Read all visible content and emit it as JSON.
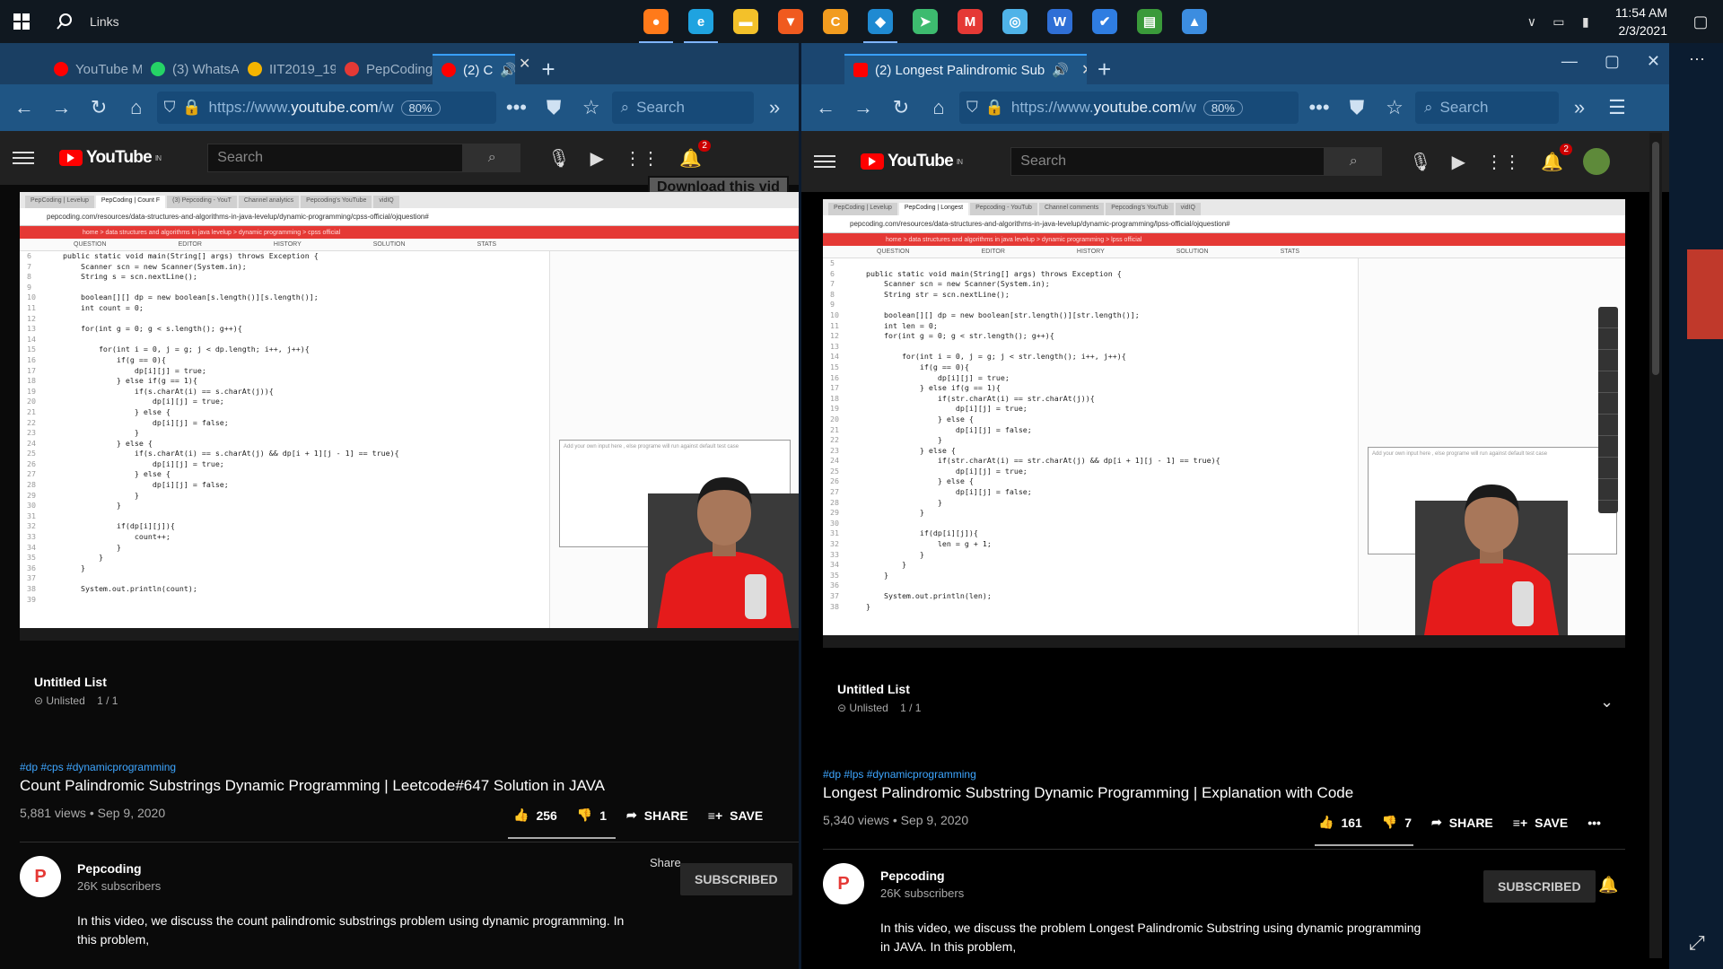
{
  "taskbar": {
    "links_label": "Links",
    "time": "11:54 AM",
    "date": "2/3/2021",
    "apps": [
      {
        "name": "firefox-icon",
        "color": "#ff7a1a",
        "glyph": "●"
      },
      {
        "name": "edge-icon",
        "color": "#1fa3e0",
        "glyph": "e"
      },
      {
        "name": "file-explorer-icon",
        "color": "#f3c12a",
        "glyph": "▬"
      },
      {
        "name": "brave-icon",
        "color": "#f05a1f",
        "glyph": "▼"
      },
      {
        "name": "c-app-icon",
        "color": "#f29c1f",
        "glyph": "C"
      },
      {
        "name": "vscode-icon",
        "color": "#1f8ad2",
        "glyph": "◆"
      },
      {
        "name": "telegram-icon",
        "color": "#3dbb6f",
        "glyph": "➤"
      },
      {
        "name": "gmail-icon",
        "color": "#e53935",
        "glyph": "M"
      },
      {
        "name": "globe-app-icon",
        "color": "#4fb3e8",
        "glyph": "◎"
      },
      {
        "name": "word-icon",
        "color": "#2f6fd6",
        "glyph": "W"
      },
      {
        "name": "todo-icon",
        "color": "#2f7de1",
        "glyph": "✔"
      },
      {
        "name": "excel-chart-icon",
        "color": "#3a9a3a",
        "glyph": "▤"
      },
      {
        "name": "photos-icon",
        "color": "#3c8de0",
        "glyph": "▲"
      }
    ]
  },
  "left": {
    "tabs": [
      {
        "label": "YouTube M",
        "color": "#ff0000"
      },
      {
        "label": "(3) WhatsA",
        "color": "#25d366"
      },
      {
        "label": "IIT2019_19",
        "color": "#f4b400"
      },
      {
        "label": "PepCoding",
        "color": "#e53935"
      },
      {
        "label": "(2) C",
        "color": "#ff0000"
      }
    ],
    "url_prefix": "https://www.",
    "url_host": "youtube.com",
    "url_suffix": "/w",
    "zoom": "80%",
    "search_placeholder": "Search",
    "yt_search_placeholder": "Search",
    "notif_count": "2",
    "download_label": "Download this vid",
    "playlist_title": "Untitled List",
    "playlist_sub": "Unlisted",
    "playlist_pos": "1 / 1",
    "tags": "#dp #cps #dynamicprogramming",
    "title": "Count Palindromic Substrings Dynamic Programming | Leetcode#647 Solution in JAVA",
    "views": "5,881 views • Sep 9, 2020",
    "likes": "256",
    "dislikes": "1",
    "share": "SHARE",
    "save": "SAVE",
    "share_tooltip": "Share",
    "channel": "Pepcoding",
    "subscribers": "26K subscribers",
    "subscribed": "SUBSCRIBED",
    "description": "In this video, we discuss the count palindromic substrings problem using dynamic programming. In this problem,"
  },
  "right": {
    "tab_label": "(2) Longest Palindromic Sub",
    "url_prefix": "https://www.",
    "url_host": "youtube.com",
    "url_suffix": "/w",
    "zoom": "80%",
    "search_placeholder": "Search",
    "yt_search_placeholder": "Search",
    "notif_count": "2",
    "playlist_title": "Untitled List",
    "playlist_sub": "Unlisted",
    "playlist_pos": "1 / 1",
    "tags": "#dp #lps #dynamicprogramming",
    "title": "Longest Palindromic Substring Dynamic Programming | Explanation with Code",
    "views": "5,340 views • Sep 9, 2020",
    "likes": "161",
    "dislikes": "7",
    "share": "SHARE",
    "save": "SAVE",
    "channel": "Pepcoding",
    "subscribers": "26K subscribers",
    "subscribed": "SUBSCRIBED",
    "description": "In this video, we discuss the problem Longest Palindromic Substring using dynamic programming in JAVA. In this problem,"
  },
  "video_left": {
    "tabs": [
      "PepCoding | Levelup",
      "PepCoding | Count F",
      "(3) Pepcoding - YouT",
      "Channel analytics",
      "Pepcoding's YouTube",
      "vidIQ"
    ],
    "address": "pepcoding.com/resources/data-structures-and-algorithms-in-java-levelup/dynamic-programming/cpss-official/ojquestion#",
    "crumb": "home > data structures and algorithms in java levelup > dynamic programming > cpss official",
    "menu": [
      "QUESTION",
      "EDITOR",
      "HISTORY",
      "SOLUTION",
      "STATS"
    ],
    "input_hint": "Add your own input here , else programe will run against default test case",
    "code": [
      [
        "6",
        "    public static void main(String[] args) throws Exception {"
      ],
      [
        "7",
        "        Scanner scn = new Scanner(System.in);"
      ],
      [
        "8",
        "        String s = scn.nextLine();"
      ],
      [
        "9",
        ""
      ],
      [
        "10",
        "        boolean[][] dp = new boolean[s.length()][s.length()];"
      ],
      [
        "11",
        "        int count = 0;"
      ],
      [
        "12",
        ""
      ],
      [
        "13",
        "        for(int g = 0; g < s.length(); g++){"
      ],
      [
        "14",
        ""
      ],
      [
        "15",
        "            for(int i = 0, j = g; j < dp.length; i++, j++){"
      ],
      [
        "16",
        "                if(g == 0){"
      ],
      [
        "17",
        "                    dp[i][j] = true;"
      ],
      [
        "18",
        "                } else if(g == 1){"
      ],
      [
        "19",
        "                    if(s.charAt(i) == s.charAt(j)){"
      ],
      [
        "20",
        "                        dp[i][j] = true;"
      ],
      [
        "21",
        "                    } else {"
      ],
      [
        "22",
        "                        dp[i][j] = false;"
      ],
      [
        "23",
        "                    }"
      ],
      [
        "24",
        "                } else {"
      ],
      [
        "25",
        "                    if(s.charAt(i) == s.charAt(j) && dp[i + 1][j - 1] == true){"
      ],
      [
        "26",
        "                        dp[i][j] = true;"
      ],
      [
        "27",
        "                    } else {"
      ],
      [
        "28",
        "                        dp[i][j] = false;"
      ],
      [
        "29",
        "                    }"
      ],
      [
        "30",
        "                }"
      ],
      [
        "31",
        ""
      ],
      [
        "32",
        "                if(dp[i][j]){"
      ],
      [
        "33",
        "                    count++;"
      ],
      [
        "34",
        "                }"
      ],
      [
        "35",
        "            }"
      ],
      [
        "36",
        "        }"
      ],
      [
        "37",
        ""
      ],
      [
        "38",
        "        System.out.println(count);"
      ],
      [
        "39",
        ""
      ]
    ]
  },
  "video_right": {
    "tabs": [
      "PepCoding | Levelup",
      "PepCoding | Longest",
      "Pepcoding - YouTub",
      "Channel comments",
      "Pepcoding's YouTub",
      "vidIQ"
    ],
    "address": "pepcoding.com/resources/data-structures-and-algorithms-in-java-levelup/dynamic-programming/lpss-official/ojquestion#",
    "crumb": "home > data structures and algorithms in java levelup > dynamic programming > lpss official",
    "menu": [
      "QUESTION",
      "EDITOR",
      "HISTORY",
      "SOLUTION",
      "STATS"
    ],
    "input_hint": "Add your own input here , else programe will run against default test case",
    "code": [
      [
        "5",
        ""
      ],
      [
        "6",
        "    public static void main(String[] args) throws Exception {"
      ],
      [
        "7",
        "        Scanner scn = new Scanner(System.in);"
      ],
      [
        "8",
        "        String str = scn.nextLine();"
      ],
      [
        "9",
        ""
      ],
      [
        "10",
        "        boolean[][] dp = new boolean[str.length()][str.length()];"
      ],
      [
        "11",
        "        int len = 0;"
      ],
      [
        "12",
        "        for(int g = 0; g < str.length(); g++){"
      ],
      [
        "13",
        ""
      ],
      [
        "14",
        "            for(int i = 0, j = g; j < str.length(); i++, j++){"
      ],
      [
        "15",
        "                if(g == 0){"
      ],
      [
        "16",
        "                    dp[i][j] = true;"
      ],
      [
        "17",
        "                } else if(g == 1){"
      ],
      [
        "18",
        "                    if(str.charAt(i) == str.charAt(j)){"
      ],
      [
        "19",
        "                        dp[i][j] = true;"
      ],
      [
        "20",
        "                    } else {"
      ],
      [
        "21",
        "                        dp[i][j] = false;"
      ],
      [
        "22",
        "                    }"
      ],
      [
        "23",
        "                } else {"
      ],
      [
        "24",
        "                    if(str.charAt(i) == str.charAt(j) && dp[i + 1][j - 1] == true){"
      ],
      [
        "25",
        "                        dp[i][j] = true;"
      ],
      [
        "26",
        "                    } else {"
      ],
      [
        "27",
        "                        dp[i][j] = false;"
      ],
      [
        "28",
        "                    }"
      ],
      [
        "29",
        "                }"
      ],
      [
        "30",
        ""
      ],
      [
        "31",
        "                if(dp[i][j]){"
      ],
      [
        "32",
        "                    len = g + 1;"
      ],
      [
        "33",
        "                }"
      ],
      [
        "34",
        "            }"
      ],
      [
        "35",
        "        }"
      ],
      [
        "36",
        ""
      ],
      [
        "37",
        "        System.out.println(len);"
      ],
      [
        "38",
        "    }"
      ]
    ]
  }
}
